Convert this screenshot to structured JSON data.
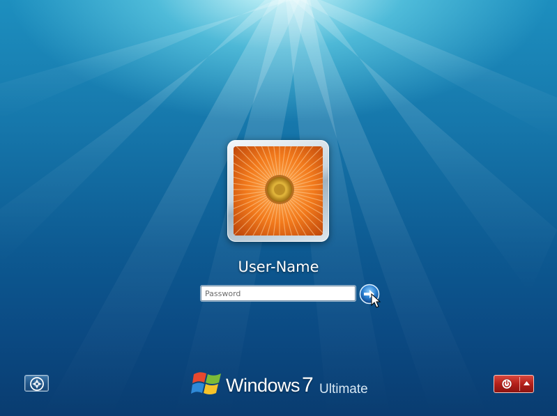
{
  "logon": {
    "user_name": "User-Name",
    "password_placeholder": "Password",
    "password_value": "",
    "user_picture": "orange-gerbera-flower"
  },
  "branding": {
    "product": "Windows",
    "version": "7",
    "edition": "Ultimate"
  },
  "controls": {
    "ease_of_access_icon": "ease-of-access-icon",
    "submit_icon": "arrow-right-icon",
    "shutdown_icon": "power-icon",
    "shutdown_options_icon": "triangle-up-icon"
  },
  "colors": {
    "background_top": "#1d8fbf",
    "background_bottom": "#093c70",
    "shutdown_red": "#b3201a",
    "submit_blue": "#2a7fd0"
  }
}
